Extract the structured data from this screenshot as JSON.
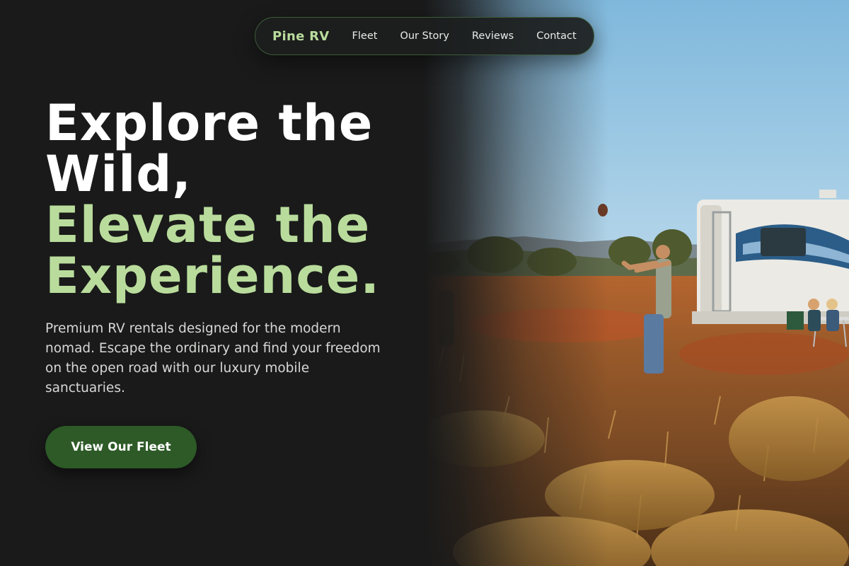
{
  "nav": {
    "brand": "Pine RV",
    "links": [
      "Fleet",
      "Our Story",
      "Reviews",
      "Contact"
    ]
  },
  "hero": {
    "headline_white": "Explore the Wild,",
    "headline_green": "Elevate the Experience.",
    "description": "Premium RV rentals designed for the modern nomad. Escape the ordinary and find your freedom on the open road with our luxury mobile sanctuaries.",
    "cta_label": "View Our Fleet",
    "image_subject": "Family camping with an RV in a desert meadow at golden hour"
  },
  "colors": {
    "background": "#1a1a1a",
    "accent_green": "#b9dc9c",
    "button_green": "#2d5a27",
    "nav_border": "#3b5a36"
  }
}
